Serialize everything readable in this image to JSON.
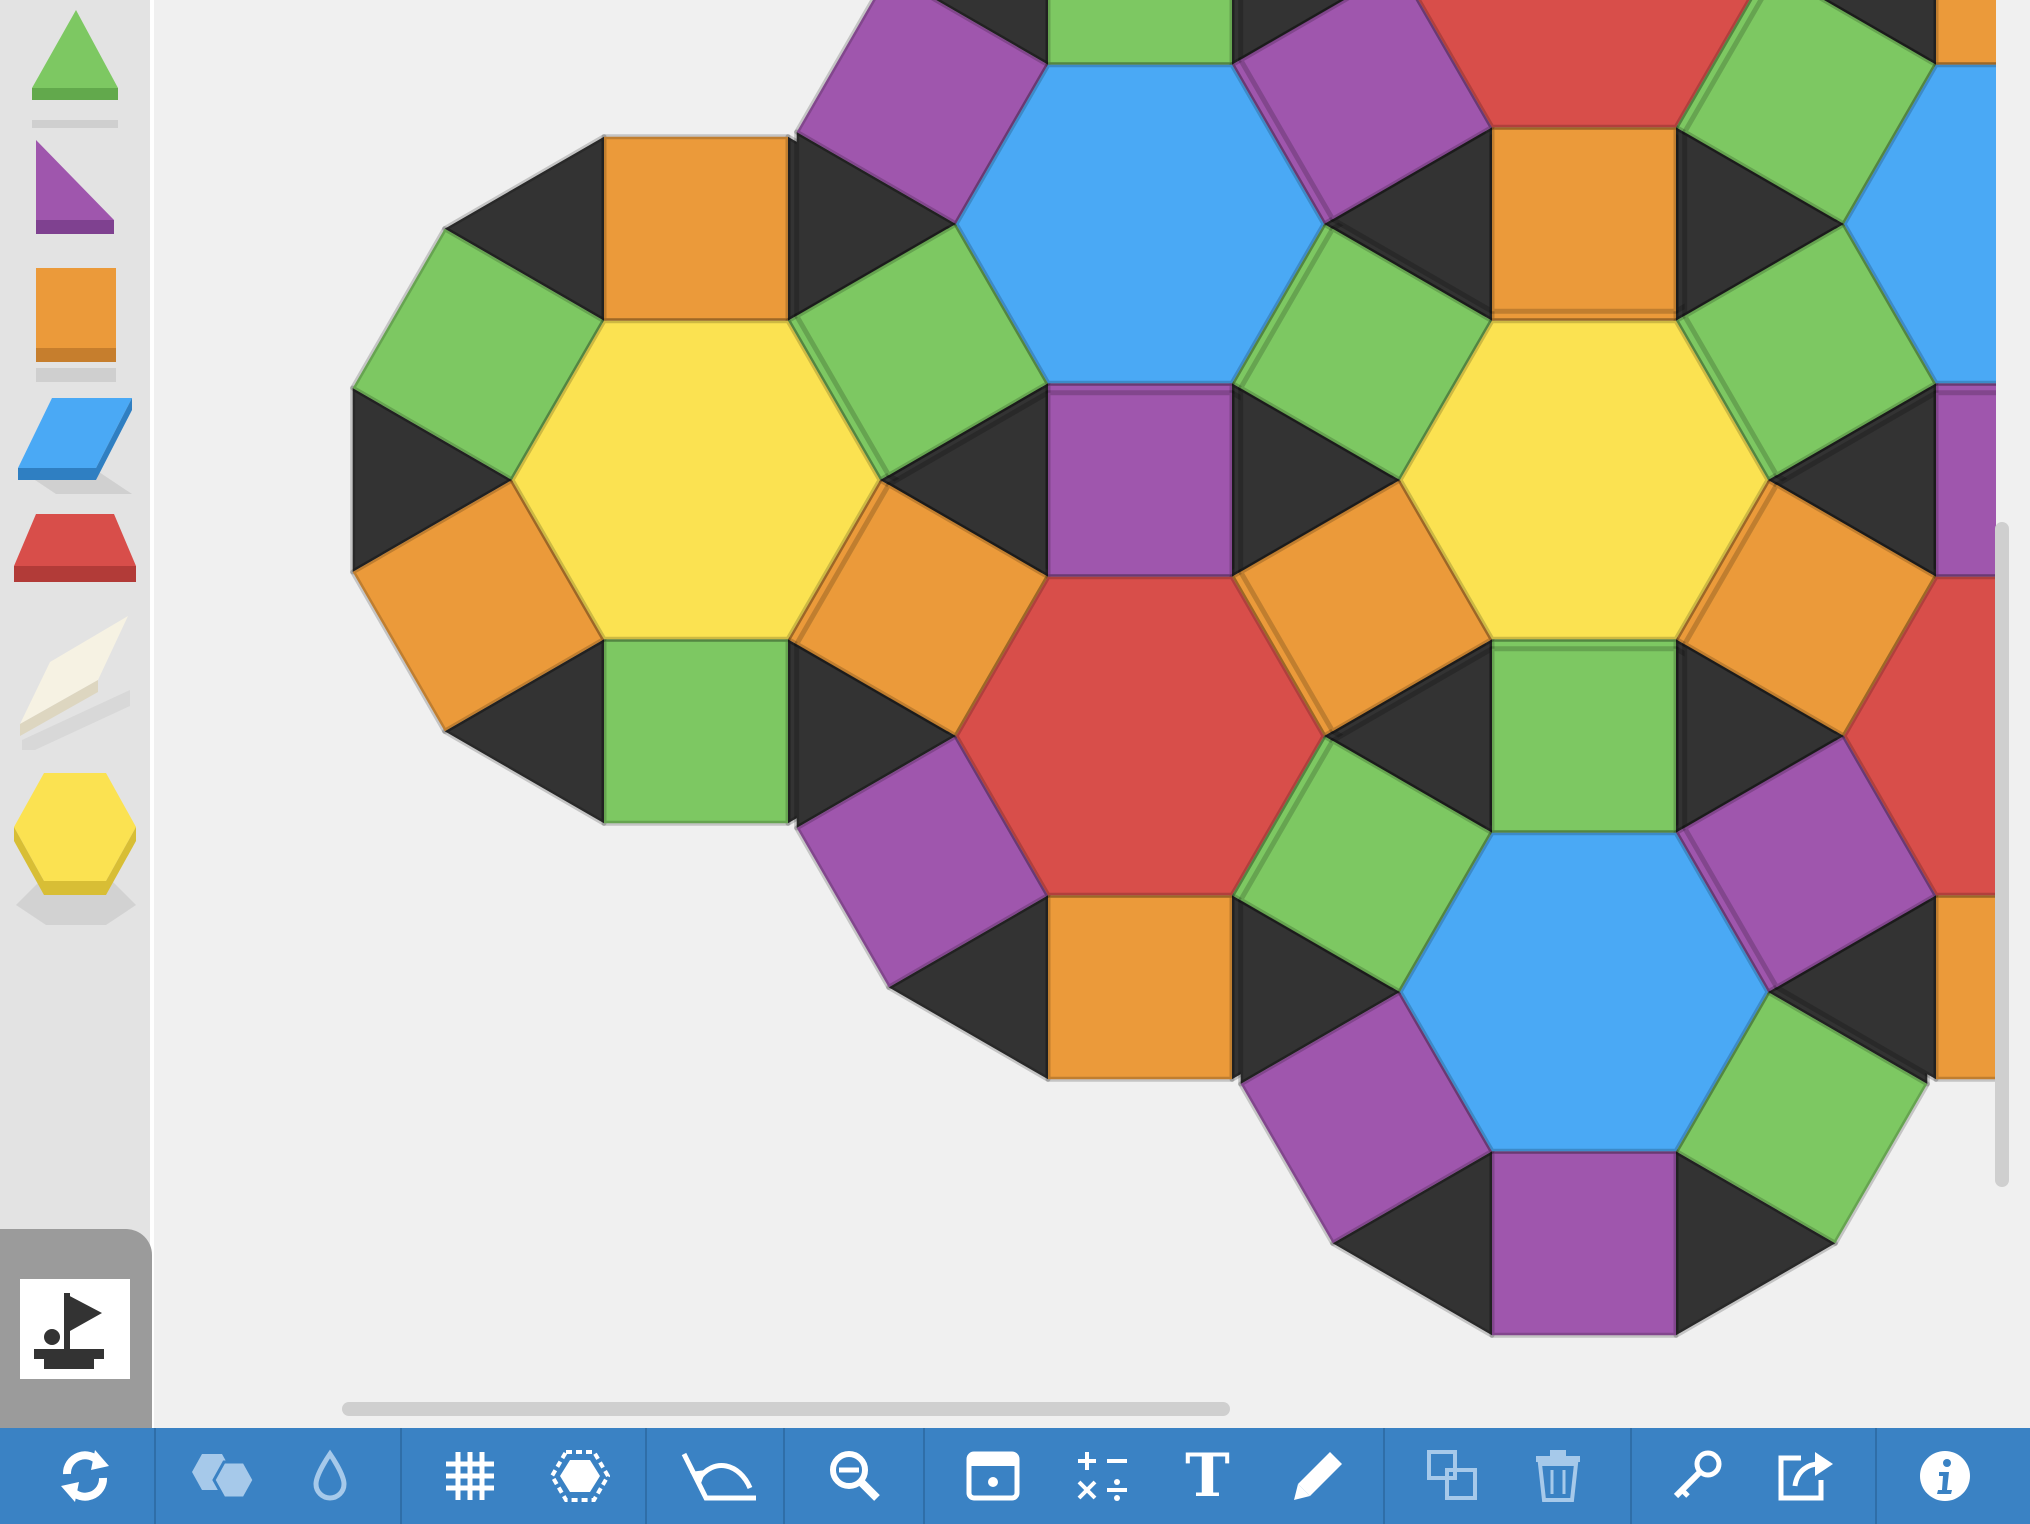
{
  "colors": {
    "triangle": "#7dc862",
    "square": "#eb9a3a",
    "hexagon": "#fbe251",
    "rhombus_blue": "#4aa9f5",
    "trapezoid": "#d84e4a",
    "tan_rhombus": "#f6f2e3",
    "purple": "#9f56ad",
    "black_triangle": "#333333",
    "toolbar": "#3a82c4",
    "sidebar": "#e3e3e3",
    "workspace": "#f0f0f0"
  },
  "palette": [
    {
      "name": "green-triangle",
      "icon": "triangle-icon"
    },
    {
      "name": "purple-right-triangle",
      "icon": "right-triangle-icon"
    },
    {
      "name": "orange-square",
      "icon": "square-icon"
    },
    {
      "name": "blue-rhombus",
      "icon": "parallelogram-icon"
    },
    {
      "name": "red-trapezoid",
      "icon": "trapezoid-icon"
    },
    {
      "name": "tan-rhombus",
      "icon": "thin-rhombus-icon"
    },
    {
      "name": "yellow-hexagon",
      "icon": "hexagon-icon"
    }
  ],
  "toolbar": {
    "tools": [
      {
        "name": "reset-button",
        "icon": "refresh-icon"
      },
      {
        "name": "shapes-button",
        "icon": "hexagons-icon"
      },
      {
        "name": "color-button",
        "icon": "droplet-icon"
      },
      {
        "name": "grid-button",
        "icon": "grid-icon"
      },
      {
        "name": "shape-outline-button",
        "icon": "dashed-hexagon-icon"
      },
      {
        "name": "angle-button",
        "icon": "angle-icon"
      },
      {
        "name": "zoom-out-button",
        "icon": "zoom-out-icon"
      },
      {
        "name": "image-button",
        "icon": "image-icon"
      },
      {
        "name": "math-button",
        "icon": "math-operators-icon"
      },
      {
        "name": "text-button",
        "icon": "text-icon"
      },
      {
        "name": "pencil-button",
        "icon": "pencil-icon"
      },
      {
        "name": "duplicate-button",
        "icon": "duplicate-icon"
      },
      {
        "name": "delete-button",
        "icon": "trash-icon"
      },
      {
        "name": "key-button",
        "icon": "key-icon"
      },
      {
        "name": "share-button",
        "icon": "share-icon"
      },
      {
        "name": "info-button",
        "icon": "info-icon"
      }
    ]
  },
  "text_tool_glyph": "T"
}
